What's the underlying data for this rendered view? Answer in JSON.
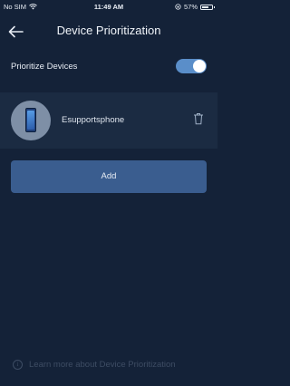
{
  "status_bar": {
    "carrier": "No SIM",
    "time": "11:49 AM",
    "battery_percent": "57%",
    "battery_level": 0.57,
    "icons": [
      "wifi-icon",
      "orientation-lock-icon",
      "battery-icon"
    ]
  },
  "header": {
    "title": "Device Prioritization",
    "back_icon": "back-arrow-icon"
  },
  "prioritize": {
    "label": "Prioritize Devices",
    "enabled": true
  },
  "devices": [
    {
      "name": "Esupportsphone",
      "icon": "smartphone-icon",
      "action_icon": "trash-icon"
    }
  ],
  "add_button": {
    "label": "Add"
  },
  "footer": {
    "learn_more_text": "Learn more about Device Prioritization",
    "info_icon_glyph": "i"
  },
  "colors": {
    "background": "#142238",
    "card": "#1b2b42",
    "accent": "#5a8ec9",
    "button": "#3a5d8f",
    "muted_text": "#3d4c63"
  }
}
